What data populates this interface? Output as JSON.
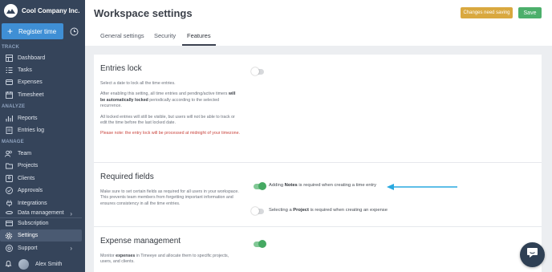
{
  "brand": {
    "name": "Cool Company Inc.",
    "logo_icon": "cloud-logo-icon"
  },
  "sidebar": {
    "register_label": "Register time",
    "sections": {
      "track": "TRACK",
      "analyze": "ANALYZE",
      "manage": "MANAGE"
    },
    "items": [
      {
        "label": "Dashboard",
        "icon": "dashboard-icon"
      },
      {
        "label": "Tasks",
        "icon": "tasks-icon"
      },
      {
        "label": "Expenses",
        "icon": "expenses-icon"
      },
      {
        "label": "Timesheet",
        "icon": "timesheet-icon"
      },
      {
        "label": "Reports",
        "icon": "reports-icon"
      },
      {
        "label": "Entries log",
        "icon": "entries-log-icon"
      },
      {
        "label": "Team",
        "icon": "team-icon"
      },
      {
        "label": "Projects",
        "icon": "projects-icon"
      },
      {
        "label": "Clients",
        "icon": "clients-icon"
      },
      {
        "label": "Approvals",
        "icon": "approvals-icon"
      },
      {
        "label": "Integrations",
        "icon": "integrations-icon"
      },
      {
        "label": "Data management",
        "icon": "data-management-icon"
      },
      {
        "label": "Subscription",
        "icon": "subscription-icon"
      },
      {
        "label": "Settings",
        "icon": "settings-icon",
        "active": true
      },
      {
        "label": "Support",
        "icon": "support-icon"
      }
    ],
    "user_name": "Alex Smith"
  },
  "header": {
    "title": "Workspace settings",
    "changes_badge": "Changes need saving",
    "save_label": "Save"
  },
  "tabs": [
    {
      "label": "General settings"
    },
    {
      "label": "Security"
    },
    {
      "label": "Features",
      "active": true
    }
  ],
  "sections": {
    "entries_lock": {
      "title": "Entries lock",
      "desc1": "Select a date to lock all the time entries.",
      "desc2_a": "After enabling this setting, all time entries and pending/active timers ",
      "desc2_b": "will be automatically locked",
      "desc2_c": " periodically according to the selected recurrence.",
      "desc3": "All locked entries will still be visible, but users will not be able to track or edit the time before the last locked date.",
      "warning": "Please note: the entry lock will be processed at midnight of your timezone.",
      "toggle_on": false
    },
    "required_fields": {
      "title": "Required fields",
      "desc": "Make sure to set certain fields as required for all users in your workspace. This prevents team members from forgetting important information and ensures consistency in all the time entries.",
      "notes_pre": "Adding ",
      "notes_bold": "Notes",
      "notes_post": " is required when creating a time entry",
      "notes_on": true,
      "project_pre": "Selecting a ",
      "project_bold": "Project",
      "project_post": " is required when creating an expense",
      "project_on": false
    },
    "expense_management": {
      "title": "Expense management",
      "desc_pre": "Monitor ",
      "desc_bold": "expenses",
      "desc_post": " in Timeeye and allocate them to specific projects, users, and clients.",
      "toggle_on": true
    }
  },
  "colors": {
    "sidebar": "#35445a",
    "accent_blue": "#3f8fd5",
    "toggle_on": "#45a962",
    "badge": "#d9a83f",
    "save": "#4caf6b",
    "arrow": "#29a9e0",
    "warning": "#c9443d"
  }
}
